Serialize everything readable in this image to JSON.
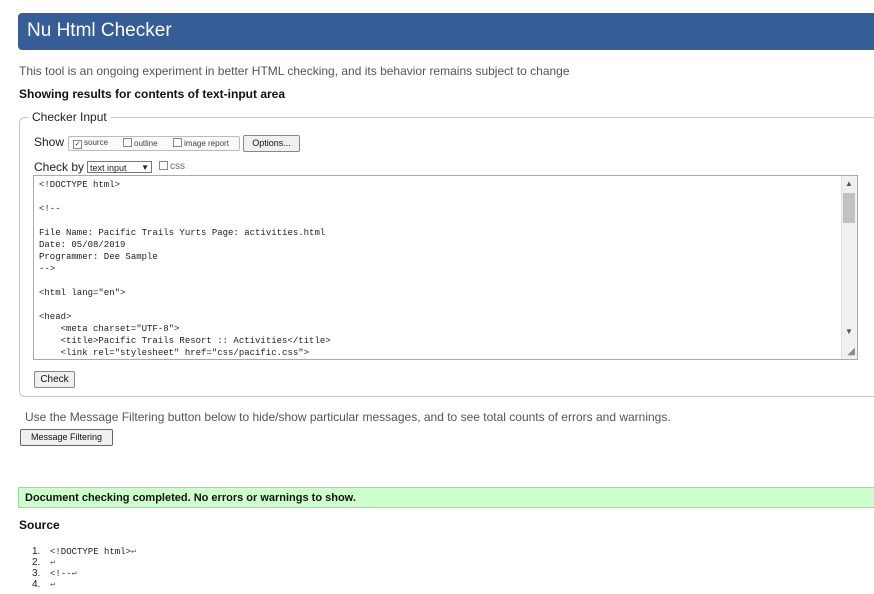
{
  "header": {
    "title": "Nu Html Checker"
  },
  "intro": "This tool is an ongoing experiment in better HTML checking, and its behavior remains subject to change",
  "results_title": "Showing results for contents of text-input area",
  "checker_input": {
    "legend": "Checker Input",
    "show_label": "Show",
    "show_options": [
      {
        "label": "source",
        "checked": true
      },
      {
        "label": "outline",
        "checked": false
      },
      {
        "label": "image report",
        "checked": false
      }
    ],
    "options_button": "Options...",
    "check_by_label": "Check by",
    "check_by_value": "text input",
    "css_label": "css",
    "source_text": "<!DOCTYPE html>\n\n<!--\n\nFile Name: Pacific Trails Yurts Page: activities.html\nDate: 05/08/2019\nProgrammer: Dee Sample\n-->\n\n<html lang=\"en\">\n\n<head>\n    <meta charset=\"UTF-8\">\n    <title>Pacific Trails Resort :: Activities</title>\n    <link rel=\"stylesheet\" href=\"css/pacific.css\">",
    "check_button": "Check"
  },
  "filtering": {
    "text": "Use the Message Filtering button below to hide/show particular messages, and to see total counts of errors and warnings.",
    "button": "Message Filtering"
  },
  "status": {
    "message": "Document checking completed. No errors or warnings to show."
  },
  "source": {
    "title": "Source",
    "lines": [
      {
        "num": "1.",
        "text": "<!DOCTYPE html>"
      },
      {
        "num": "2.",
        "text": ""
      },
      {
        "num": "3.",
        "text": "<!--"
      },
      {
        "num": "4.",
        "text": ""
      }
    ],
    "return_glyph": "↩"
  },
  "colors": {
    "header_bg": "#365d95",
    "success_bg": "#ccffcc"
  }
}
